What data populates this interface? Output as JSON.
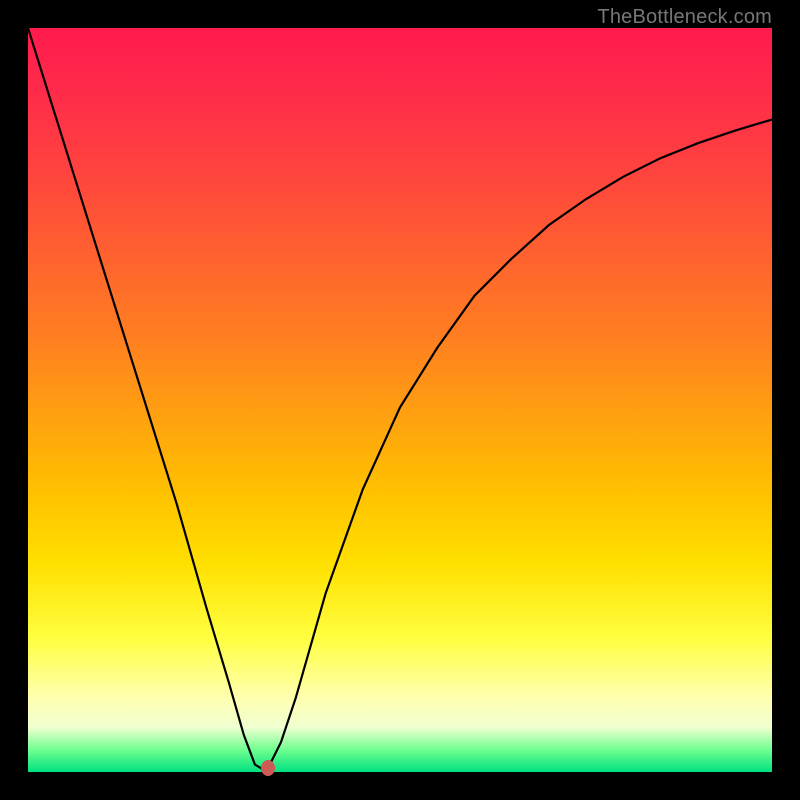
{
  "watermark": "TheBottleneck.com",
  "chart_data": {
    "type": "line",
    "title": "",
    "xlabel": "",
    "ylabel": "",
    "xlim": [
      0,
      100
    ],
    "ylim": [
      0,
      100
    ],
    "grid": false,
    "series": [
      {
        "name": "curve",
        "color": "#000000",
        "x": [
          0,
          5,
          10,
          15,
          20,
          24,
          27,
          29,
          30.5,
          31.5,
          32.5,
          34,
          36,
          40,
          45,
          50,
          55,
          60,
          65,
          70,
          75,
          80,
          85,
          90,
          95,
          100
        ],
        "y": [
          100,
          84,
          68,
          52,
          36,
          22,
          12,
          5,
          1,
          0.4,
          1,
          4,
          10,
          24,
          38,
          49,
          57,
          64,
          69,
          73.5,
          77,
          80,
          82.5,
          84.5,
          86.2,
          87.7
        ]
      }
    ],
    "marker": {
      "x": 32.2,
      "y": 0.6,
      "color": "#cc5a55"
    },
    "background_gradient": {
      "stops": [
        {
          "pos": 0,
          "color": "#ff1a4d"
        },
        {
          "pos": 18,
          "color": "#ff4040"
        },
        {
          "pos": 42,
          "color": "#ff8020"
        },
        {
          "pos": 62,
          "color": "#ffc000"
        },
        {
          "pos": 82,
          "color": "#ffff40"
        },
        {
          "pos": 94,
          "color": "#f0ffd0"
        },
        {
          "pos": 100,
          "color": "#00e080"
        }
      ]
    }
  }
}
